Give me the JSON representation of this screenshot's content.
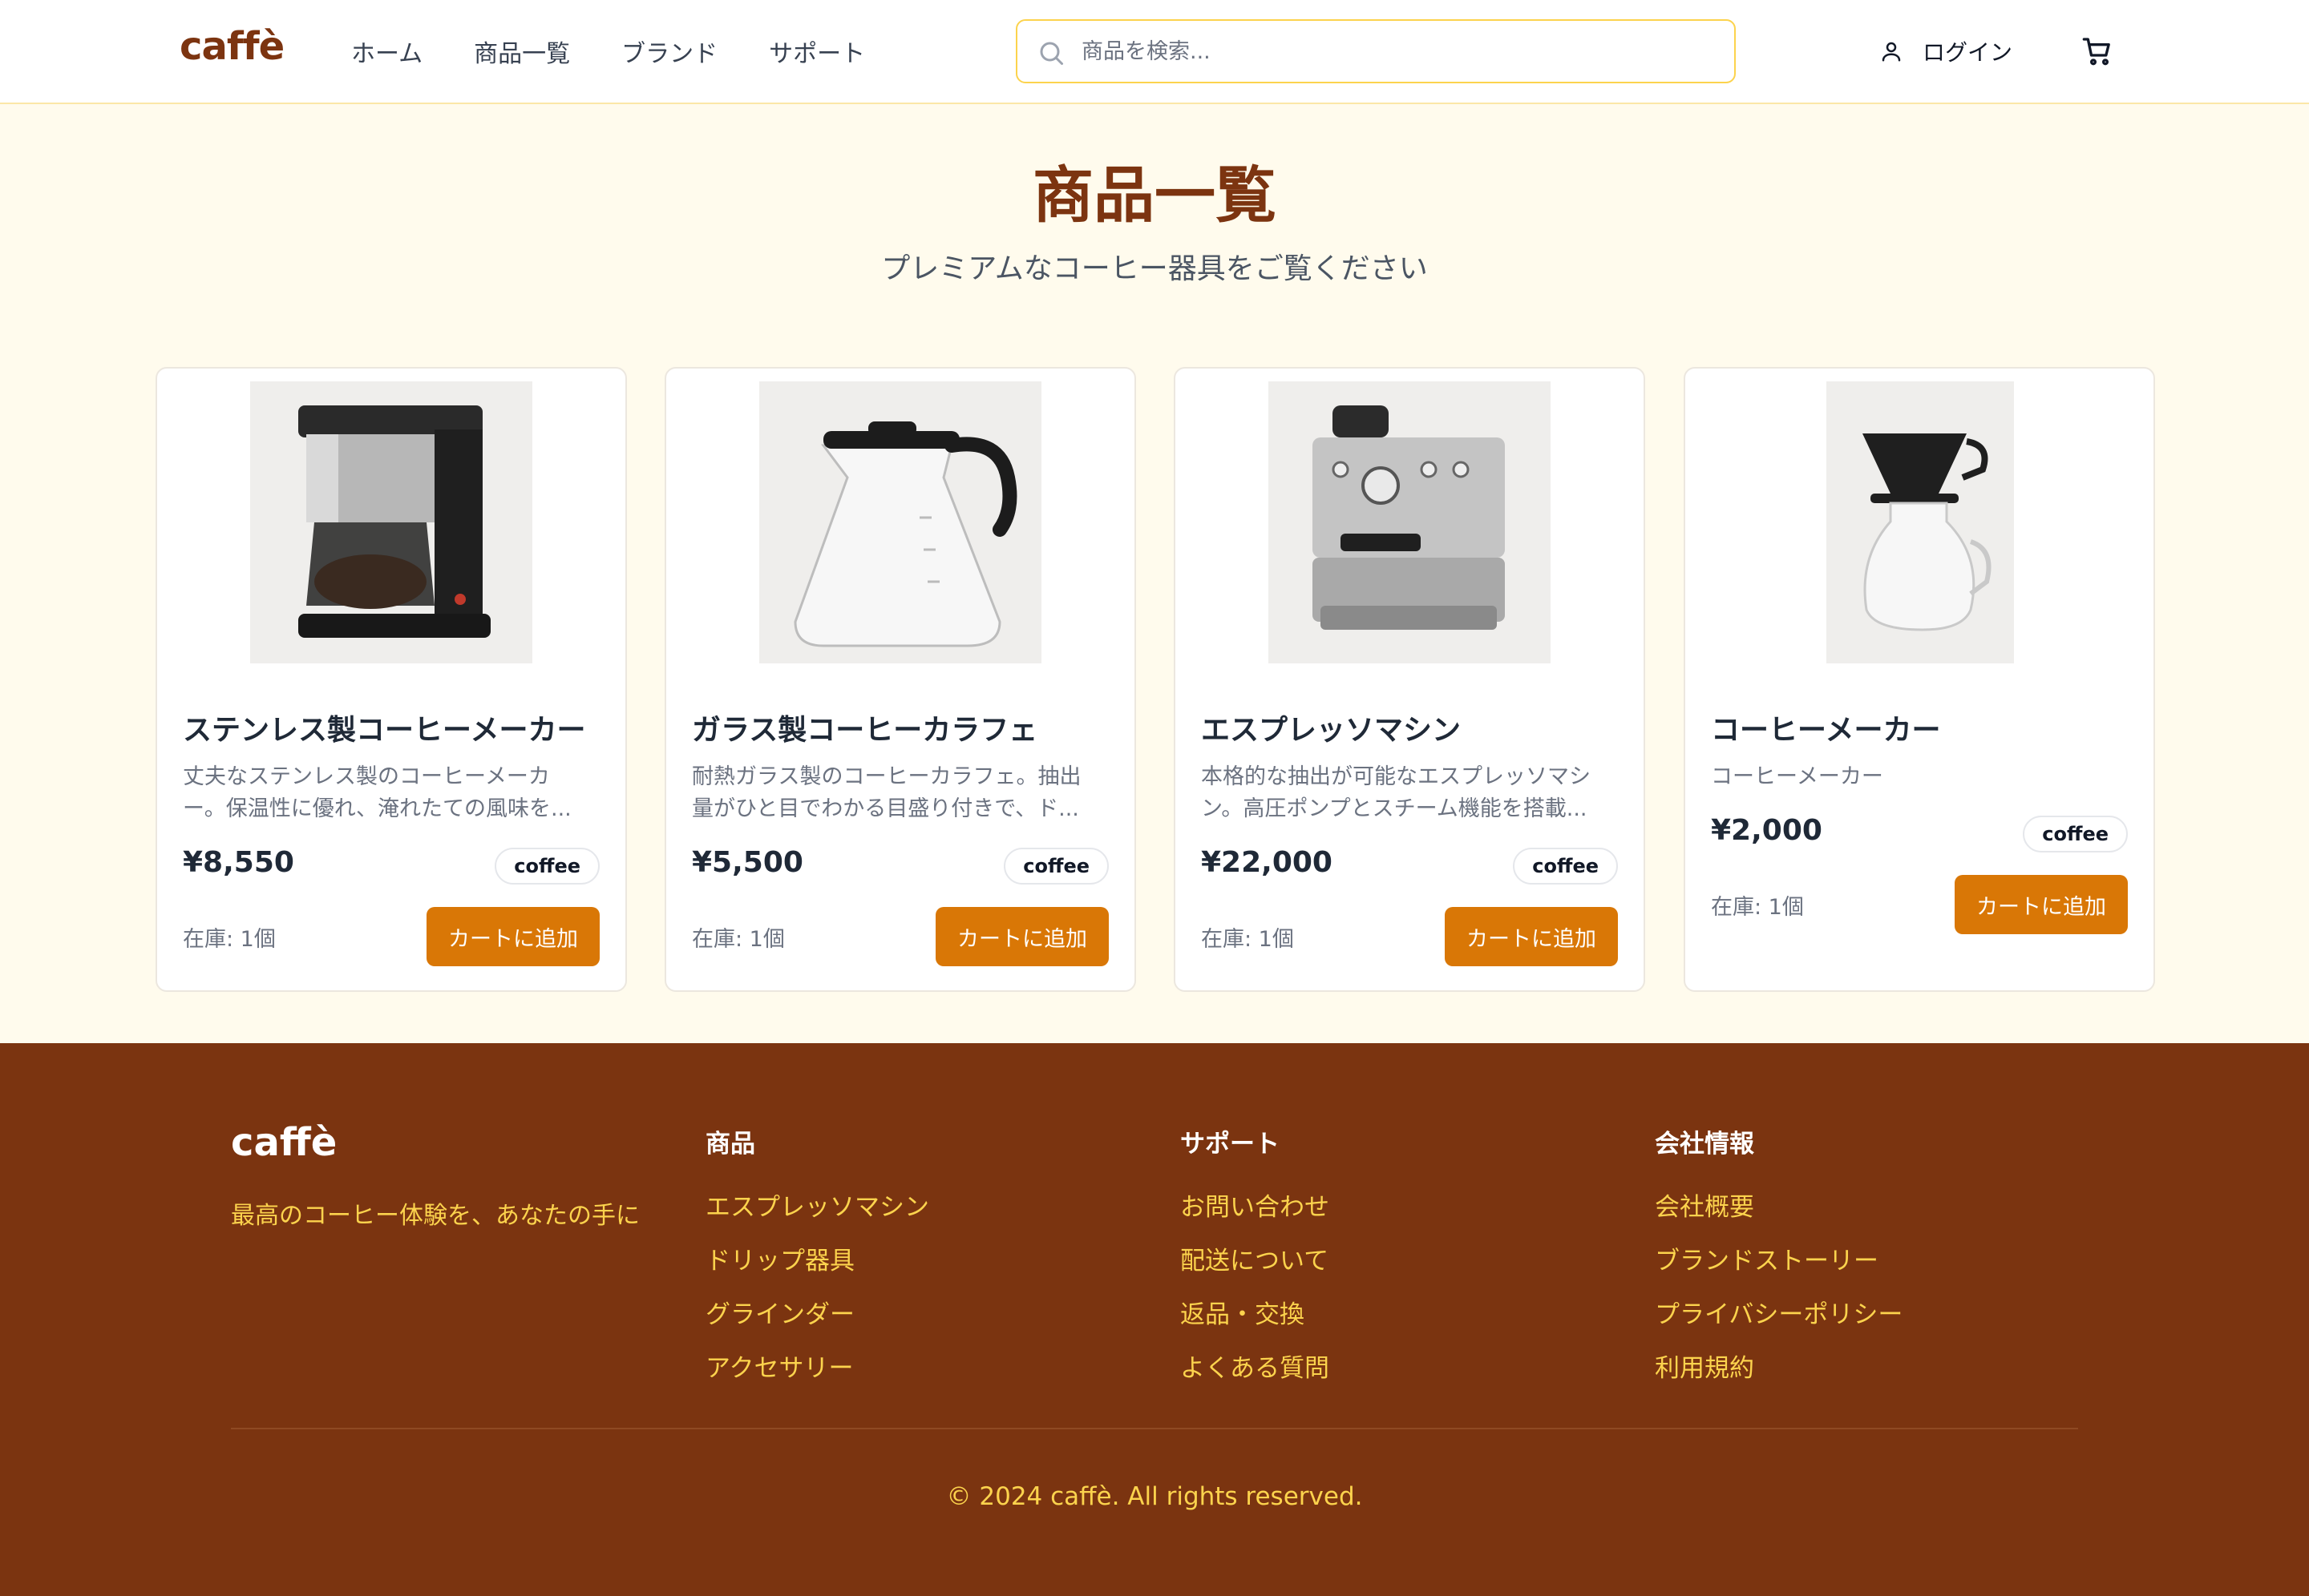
{
  "header": {
    "logo": "caffè",
    "nav": [
      "ホーム",
      "商品一覧",
      "ブランド",
      "サポート"
    ],
    "search_placeholder": "商品を検索...",
    "login": "ログイン"
  },
  "hero": {
    "title": "商品一覧",
    "subtitle": "プレミアムなコーヒー器具をご覧ください"
  },
  "products": [
    {
      "name": "ステンレス製コーヒーメーカー",
      "description": "丈夫なステンレス製のコーヒーメーカー。保温性に優れ、淹れたての風味を...",
      "price": "¥8,550",
      "tag": "coffee",
      "stock": "在庫: 1個",
      "button": "カートに追加",
      "image": "drip-coffee-maker"
    },
    {
      "name": "ガラス製コーヒーカラフェ",
      "description": "耐熱ガラス製のコーヒーカラフェ。抽出量がひと目でわかる目盛り付きで、ド...",
      "price": "¥5,500",
      "tag": "coffee",
      "stock": "在庫: 1個",
      "button": "カートに追加",
      "image": "glass-carafe"
    },
    {
      "name": "エスプレッソマシン",
      "description": "本格的な抽出が可能なエスプレッソマシン。高圧ポンプとスチーム機能を搭載...",
      "price": "¥22,000",
      "tag": "coffee",
      "stock": "在庫: 1個",
      "button": "カートに追加",
      "image": "espresso-machine"
    },
    {
      "name": "コーヒーメーカー",
      "description": "コーヒーメーカー",
      "price": "¥2,000",
      "tag": "coffee",
      "stock": "在庫: 1個",
      "button": "カートに追加",
      "image": "pour-over-dripper"
    }
  ],
  "footer": {
    "logo": "caffè",
    "tagline": "最高のコーヒー体験を、あなたの手に",
    "columns": [
      {
        "title": "商品",
        "links": [
          "エスプレッソマシン",
          "ドリップ器具",
          "グラインダー",
          "アクセサリー"
        ]
      },
      {
        "title": "サポート",
        "links": [
          "お問い合わせ",
          "配送について",
          "返品・交換",
          "よくある質問"
        ]
      },
      {
        "title": "会社情報",
        "links": [
          "会社概要",
          "ブランドストーリー",
          "プライバシーポリシー",
          "利用規約"
        ]
      }
    ],
    "copyright": "© 2024 caffè. All rights reserved."
  },
  "colors": {
    "brand": "#7c3410",
    "accent": "#d97706",
    "page_bg": "#fffbed",
    "footer_bg": "#7b3410",
    "footer_link": "#fcd34d"
  }
}
